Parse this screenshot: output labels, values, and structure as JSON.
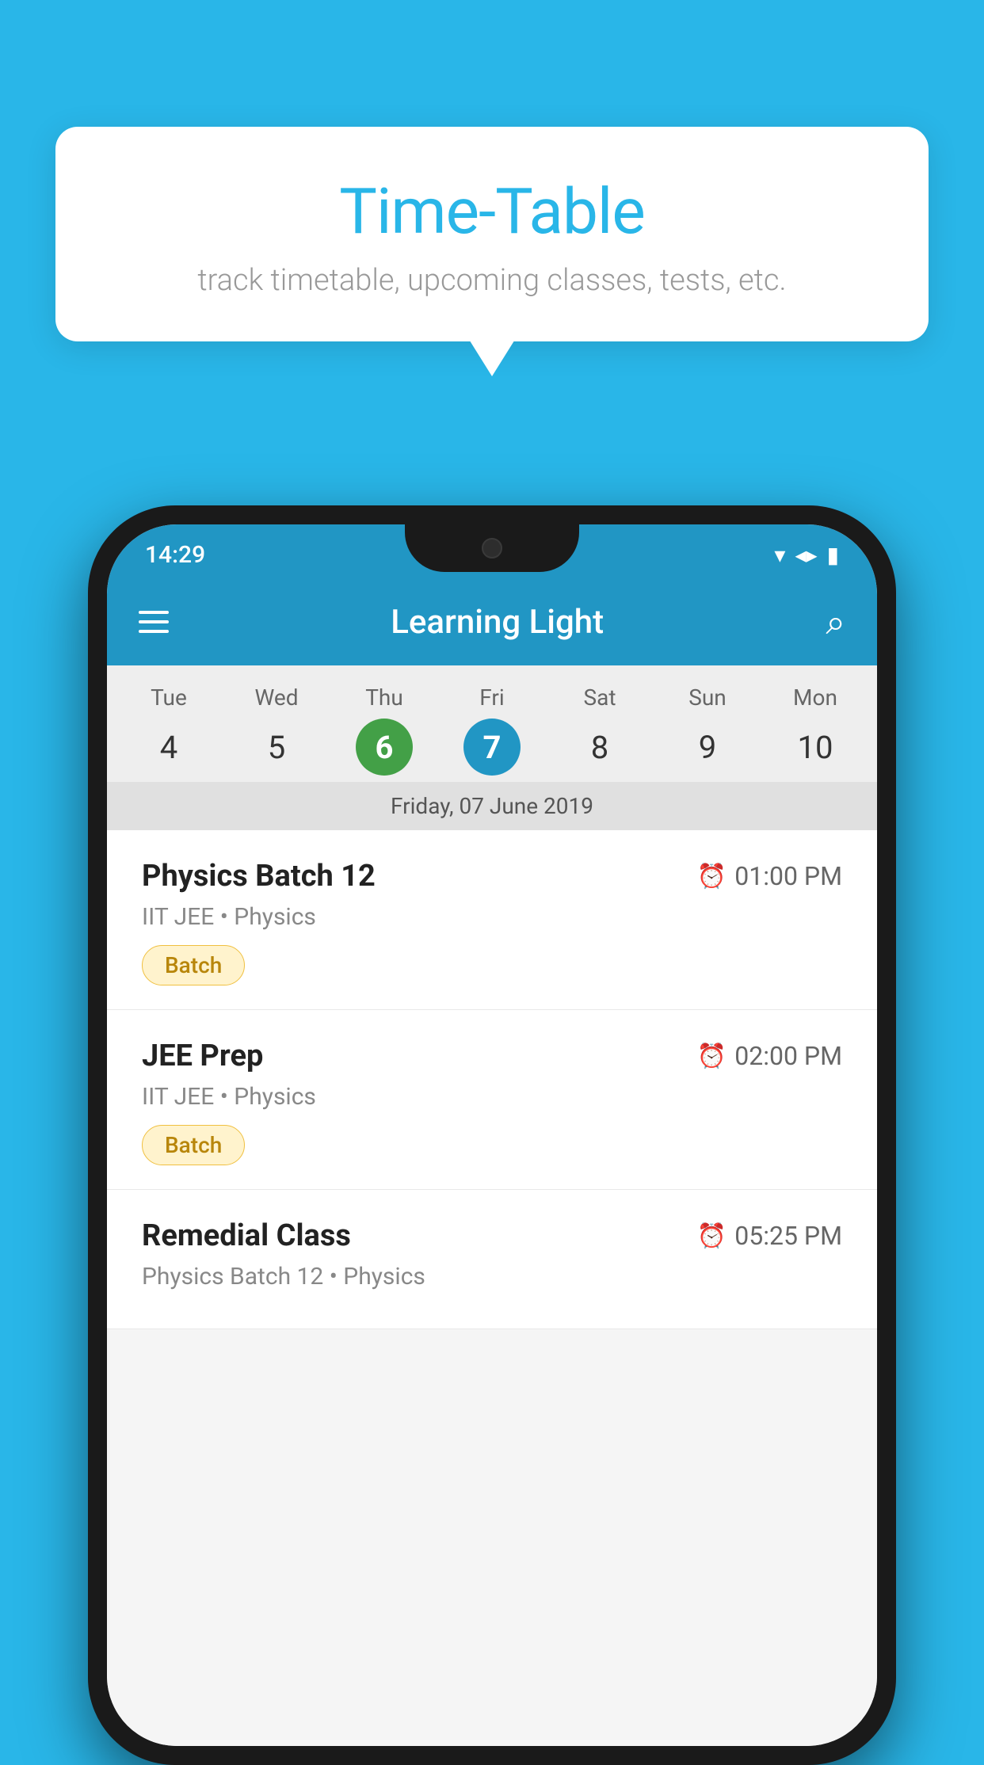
{
  "background_color": "#29b6e8",
  "tooltip": {
    "title": "Time-Table",
    "subtitle": "track timetable, upcoming classes, tests, etc."
  },
  "phone": {
    "status_bar": {
      "time": "14:29"
    },
    "app_bar": {
      "title": "Learning Light"
    },
    "calendar": {
      "days": [
        {
          "name": "Tue",
          "num": "4",
          "state": "normal"
        },
        {
          "name": "Wed",
          "num": "5",
          "state": "normal"
        },
        {
          "name": "Thu",
          "num": "6",
          "state": "today"
        },
        {
          "name": "Fri",
          "num": "7",
          "state": "selected"
        },
        {
          "name": "Sat",
          "num": "8",
          "state": "normal"
        },
        {
          "name": "Sun",
          "num": "9",
          "state": "normal"
        },
        {
          "name": "Mon",
          "num": "10",
          "state": "normal"
        }
      ],
      "selected_date_label": "Friday, 07 June 2019"
    },
    "schedule": [
      {
        "title": "Physics Batch 12",
        "time": "01:00 PM",
        "subtitle": "IIT JEE • Physics",
        "badge": "Batch"
      },
      {
        "title": "JEE Prep",
        "time": "02:00 PM",
        "subtitle": "IIT JEE • Physics",
        "badge": "Batch"
      },
      {
        "title": "Remedial Class",
        "time": "05:25 PM",
        "subtitle": "Physics Batch 12 • Physics",
        "badge": null
      }
    ]
  }
}
